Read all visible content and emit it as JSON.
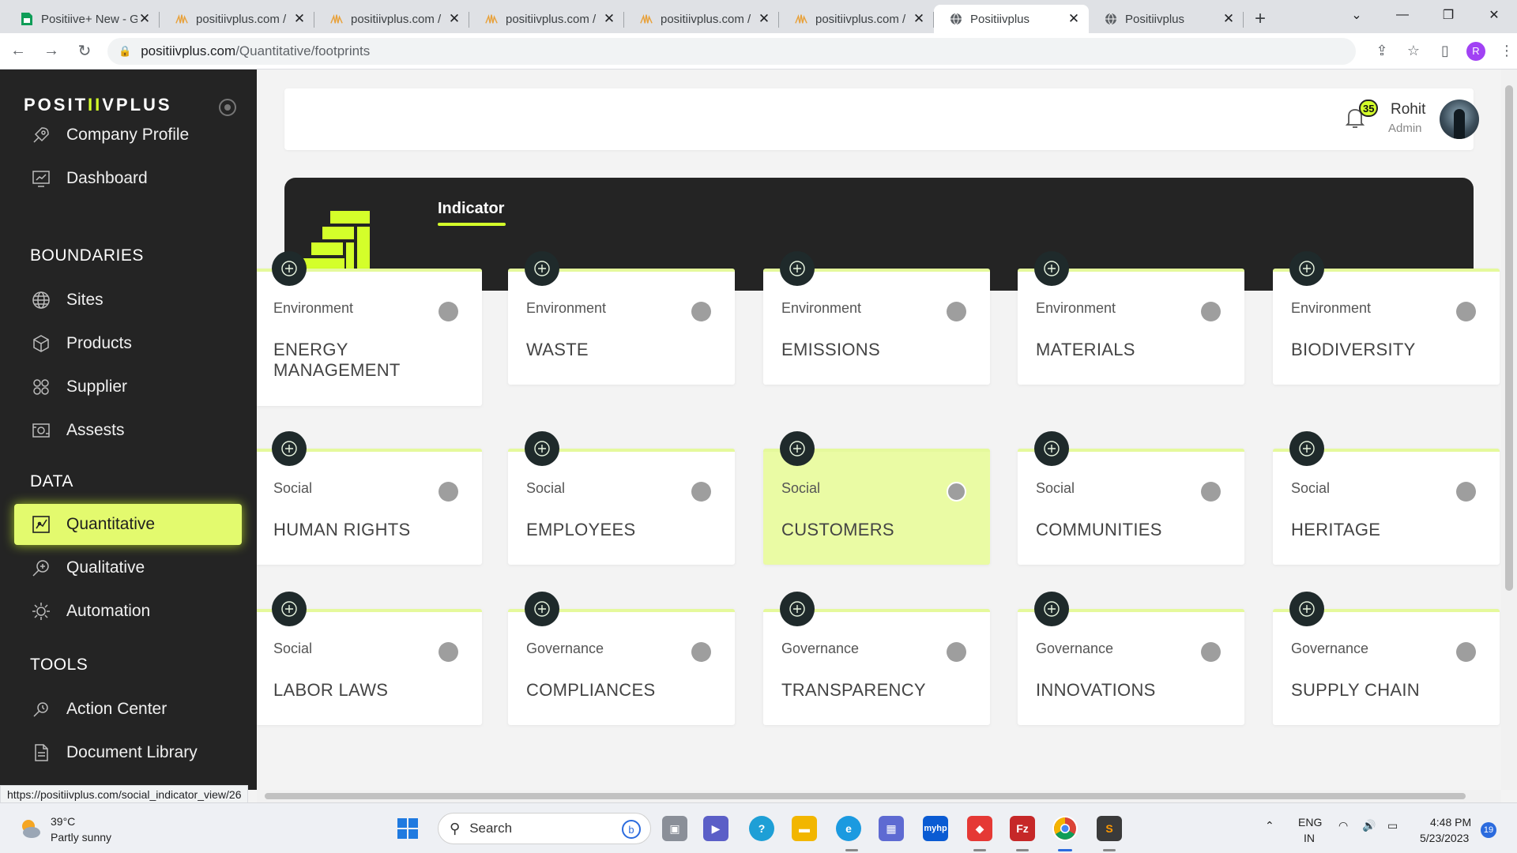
{
  "browser": {
    "tabs": [
      {
        "title": "Positiive+ New - G",
        "favicon": "sheets-icon",
        "active": false
      },
      {
        "title": "positiivplus.com /",
        "favicon": "phpmyadmin-icon",
        "active": false
      },
      {
        "title": "positiivplus.com /",
        "favicon": "phpmyadmin-icon",
        "active": false
      },
      {
        "title": "positiivplus.com /",
        "favicon": "phpmyadmin-icon",
        "active": false
      },
      {
        "title": "positiivplus.com /",
        "favicon": "phpmyadmin-icon",
        "active": false
      },
      {
        "title": "positiivplus.com /",
        "favicon": "phpmyadmin-icon",
        "active": false
      },
      {
        "title": "Positiivplus",
        "favicon": "globe-icon",
        "active": true
      },
      {
        "title": "Positiivplus",
        "favicon": "globe-icon",
        "active": false
      }
    ],
    "url_host": "positiivplus.com",
    "url_path": "/Quantitative/footprints",
    "profile_initial": "R",
    "status_url": "https://positiivplus.com/social_indicator_view/26"
  },
  "sidebar": {
    "logo_pre": "POSIT",
    "logo_mid": "II",
    "logo_post": "VPLUS",
    "items_top": [
      {
        "label": "Company Profile",
        "icon": "rocket-icon"
      },
      {
        "label": "Dashboard",
        "icon": "dashboard-icon"
      }
    ],
    "sections": {
      "boundaries": "BOUNDARIES",
      "data": "DATA",
      "tools": "TOOLS"
    },
    "boundaries_items": [
      {
        "label": "Sites",
        "icon": "globe-icon"
      },
      {
        "label": "Products",
        "icon": "box-icon"
      },
      {
        "label": "Supplier",
        "icon": "supplier-icon"
      },
      {
        "label": "Assests",
        "icon": "assets-icon"
      }
    ],
    "data_items": [
      {
        "label": "Quantitative",
        "icon": "quantitative-icon",
        "active": true
      },
      {
        "label": "Qualitative",
        "icon": "qualitative-icon"
      },
      {
        "label": "Automation",
        "icon": "automation-icon"
      }
    ],
    "tools_items": [
      {
        "label": "Action Center",
        "icon": "action-center-icon"
      },
      {
        "label": "Document Library",
        "icon": "document-icon"
      }
    ]
  },
  "header": {
    "notification_count": "35",
    "user_name": "Rohit",
    "user_role": "Admin"
  },
  "hero": {
    "tab_label": "Indicator"
  },
  "cards": [
    {
      "category": "Environment",
      "name": "ENERGY MANAGEMENT",
      "icon": "energy-icon"
    },
    {
      "category": "Environment",
      "name": "WASTE",
      "icon": "waste-icon"
    },
    {
      "category": "Environment",
      "name": "EMISSIONS",
      "icon": "emissions-icon"
    },
    {
      "category": "Environment",
      "name": "MATERIALS",
      "icon": "materials-icon"
    },
    {
      "category": "Environment",
      "name": "BIODIVERSITY",
      "icon": "biodiversity-icon"
    },
    {
      "category": "Social",
      "name": "HUMAN RIGHTS",
      "icon": "human-rights-icon"
    },
    {
      "category": "Social",
      "name": "EMPLOYEES",
      "icon": "employees-icon"
    },
    {
      "category": "Social",
      "name": "CUSTOMERS",
      "icon": "customers-icon",
      "selected": true
    },
    {
      "category": "Social",
      "name": "COMMUNITIES",
      "icon": "communities-icon"
    },
    {
      "category": "Social",
      "name": "HERITAGE",
      "icon": "heritage-icon"
    },
    {
      "category": "Social",
      "name": "LABOR LAWS",
      "icon": "labor-laws-icon"
    },
    {
      "category": "Governance",
      "name": "COMPLIANCES",
      "icon": "compliances-icon"
    },
    {
      "category": "Governance",
      "name": "TRANSPARENCY",
      "icon": "transparency-icon"
    },
    {
      "category": "Governance",
      "name": "INNOVATIONS",
      "icon": "innovations-icon"
    },
    {
      "category": "Governance",
      "name": "SUPPLY CHAIN",
      "icon": "supply-chain-icon"
    }
  ],
  "taskbar": {
    "weather_temp": "39°C",
    "weather_desc": "Partly sunny",
    "search_placeholder": "Search",
    "lang_line1": "ENG",
    "lang_line2": "IN",
    "time": "4:48 PM",
    "date": "5/23/2023",
    "notification_count": "19",
    "mylo_label": "myhp"
  },
  "colors": {
    "accent": "#d4ff2a",
    "active_nav": "#e3fa6e",
    "sidebar_bg": "#242424",
    "selected_card": "#eafba4"
  }
}
